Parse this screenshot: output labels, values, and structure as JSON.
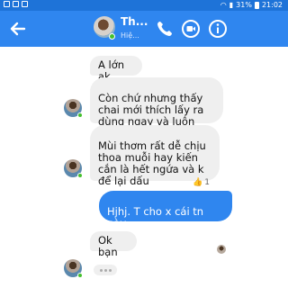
{
  "status_bar": {
    "signal": "31%",
    "time": "21:02"
  },
  "header": {
    "name": "Th...",
    "status": "Hiệ..."
  },
  "messages": [
    {
      "text": "A lớn ak",
      "dir": "in"
    },
    {
      "text": "Còn chứ nhưng thấy\nchai mới thích lấy ra\ndùng ngay và luôn",
      "dir": "in"
    },
    {
      "text": "Mùi thơm rất dễ chịu\nthoa muỗi hay kiến\ncắn là hết ngứa và k\nđể lại dấu",
      "dir": "in"
    },
    {
      "text": "Hjhj. T cho x cái tn này\nđăng fb hén",
      "dir": "out"
    },
    {
      "text": "Ok bạn",
      "dir": "in"
    }
  ],
  "reaction": {
    "count": "1"
  },
  "colors": {
    "header": "#2f86ef",
    "status_bar": "#1e73d8",
    "bubble_in": "#efefef",
    "bubble_out": "#2f86ef",
    "online": "#44c02c"
  },
  "icons": [
    "back-arrow-icon",
    "phone-icon",
    "video-camera-icon",
    "info-icon",
    "thumbs-up-icon"
  ]
}
